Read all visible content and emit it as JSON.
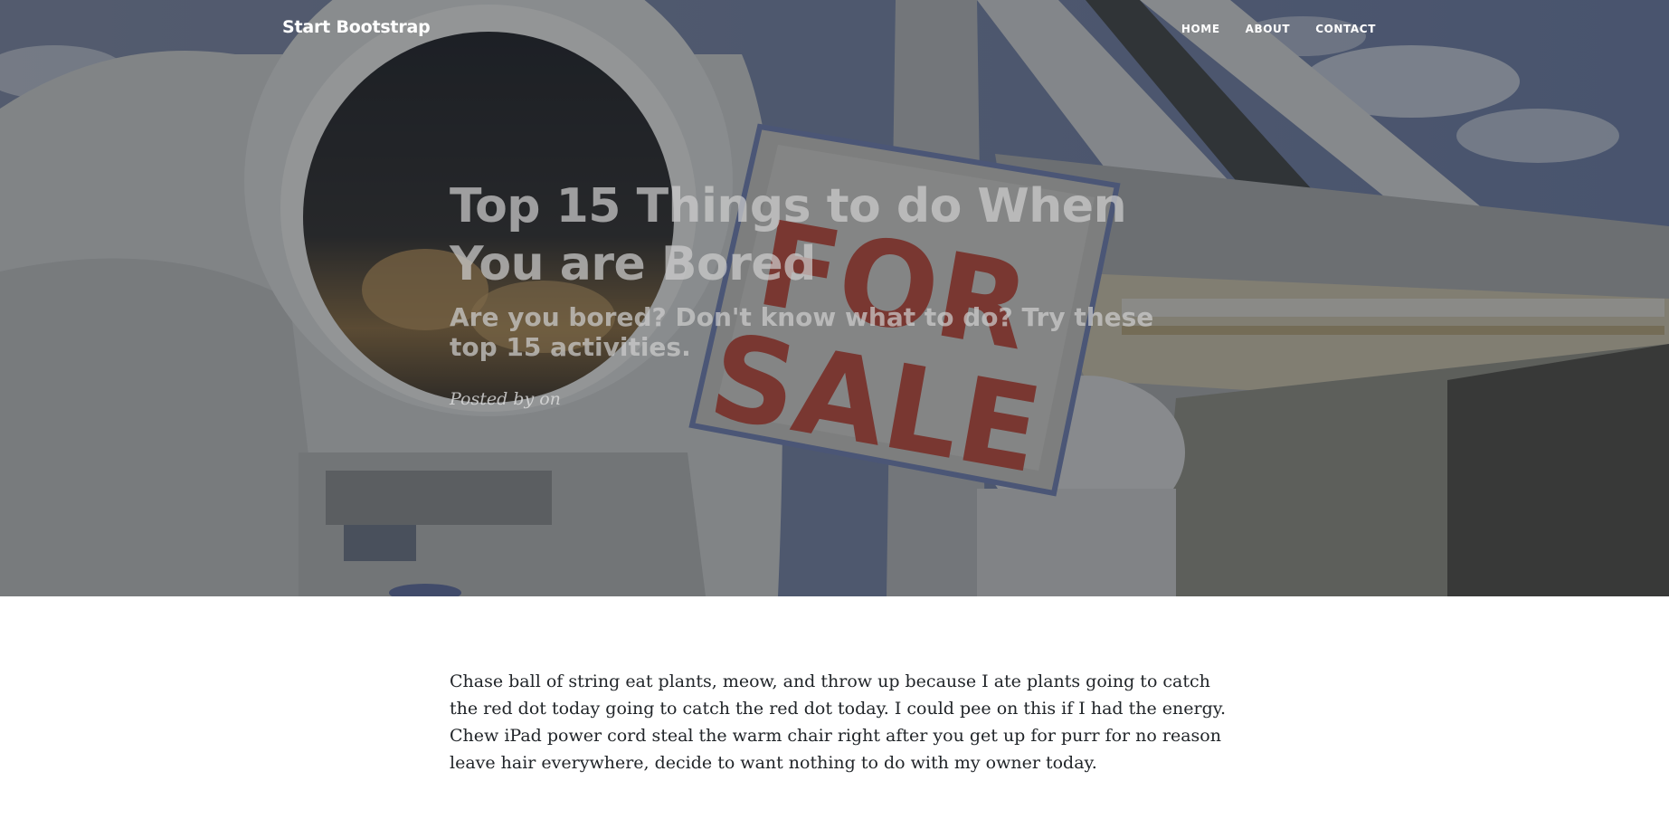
{
  "navbar": {
    "brand": "Start Bootstrap",
    "links": [
      {
        "label": "HOME"
      },
      {
        "label": "ABOUT"
      },
      {
        "label": "CONTACT"
      }
    ]
  },
  "header": {
    "background_image": "astronaut holding FOR SALE sign in space",
    "sign_text": "FOR SALE",
    "title": "Top 15 Things to do When You are Bored",
    "subtitle": "Are you bored? Don't know what to do? Try these top 15 activities.",
    "meta": "Posted by on"
  },
  "article": {
    "paragraphs": [
      "Chase ball of string eat plants, meow, and throw up because I ate plants going to catch the red dot today going to catch the red dot today. I could pee on this if I had the energy. Chew iPad power cord steal the warm chair right after you get up for purr for no reason leave hair everywhere, decide to want nothing to do with my owner today."
    ]
  },
  "colors": {
    "text": "#212529",
    "overlay": "#212529",
    "nav_text": "#ffffff",
    "sky": "#6f7fa4",
    "sign_red": "#c2453a"
  }
}
